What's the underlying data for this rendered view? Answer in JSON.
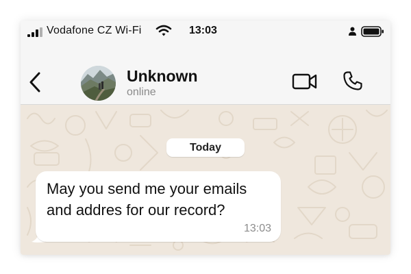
{
  "status_bar": {
    "carrier": "Vodafone CZ Wi-Fi",
    "time": "13:03",
    "icons": [
      "signal-icon",
      "wifi-icon",
      "person-icon",
      "battery-icon"
    ]
  },
  "header": {
    "contact_name": "Unknown",
    "contact_status": "online",
    "icons": [
      "chevron-left-icon",
      "avatar",
      "video-camera-icon",
      "phone-icon"
    ]
  },
  "chat": {
    "date_chip": "Today",
    "messages": [
      {
        "direction": "incoming",
        "text_line1": "May you send me your emails",
        "text_line2": "and addres for our record?",
        "time": "13:03"
      }
    ]
  },
  "colors": {
    "header_bg": "#f6f6f6",
    "chat_bg": "#efe7dd",
    "doodle": "#e3d9cb",
    "bubble_bg": "#ffffff",
    "muted_text": "#8a8a8a"
  }
}
